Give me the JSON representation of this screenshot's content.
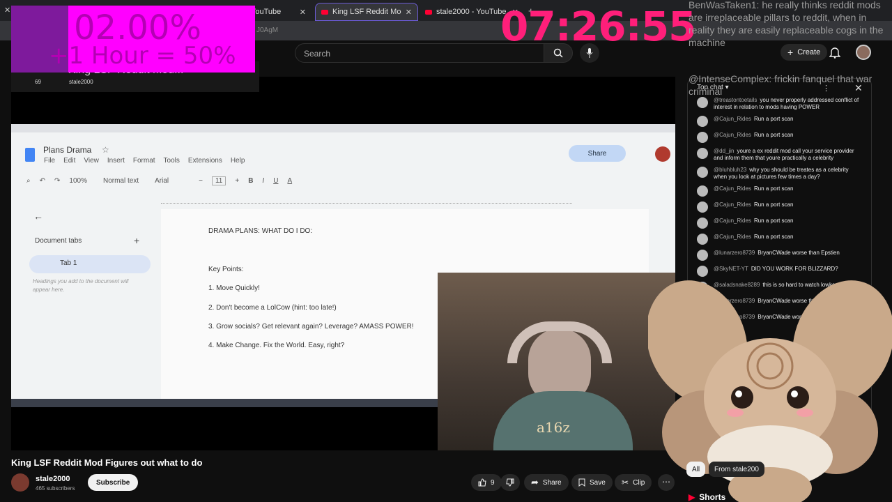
{
  "browser": {
    "tabs": [
      {
        "label": "YouTube",
        "active": false
      },
      {
        "label": "King LSF Reddit Mod Figur",
        "active": true
      },
      {
        "label": "stale2000 - YouTube",
        "active": false
      }
    ],
    "url_fragment": "J0AgM"
  },
  "overlay": {
    "percent": "02.00%",
    "rule": "+1 Hour = 50%",
    "clock": "07:26:55"
  },
  "header": {
    "search_placeholder": "Search",
    "create_label": "Create"
  },
  "mini_player": {
    "title": "King LSF Reddit Mod...",
    "views": "69",
    "channel": "stale2000"
  },
  "doc": {
    "title": "Plans Drama",
    "menu": [
      "File",
      "Edit",
      "View",
      "Insert",
      "Format",
      "Tools",
      "Extensions",
      "Help"
    ],
    "zoom": "100%",
    "style": "Normal text",
    "font": "Arial",
    "font_size": "11",
    "share_label": "Share",
    "document_tabs_label": "Document tabs",
    "tab1_label": "Tab 1",
    "headings_hint": "Headings you add to the document will appear here.",
    "lines": [
      "DRAMA PLANS:  WHAT DO I DO:",
      "Key Points:",
      "1. Move Quickly!",
      "2.  Don't become a LolCow (hint: too late!)",
      "3. Grow socials?  Get relevant again?  Leverage? AMASS POWER!",
      "4. Make Change.  Fix the World. Easy, right?"
    ]
  },
  "webcam": {
    "shirt_text": "a16z"
  },
  "video": {
    "title": "King LSF Reddit Mod Figures out what to do",
    "channel": "stale2000",
    "subscribers": "465 subscribers",
    "subscribe_label": "Subscribe",
    "likes": "9",
    "share_label": "Share",
    "save_label": "Save",
    "clip_label": "Clip"
  },
  "chat": {
    "overlay_top": "BenWasTaken1: he really thinks reddit mods are irreplaceable pillars to reddit, when in reality they are easily replaceable cogs in the machine",
    "overlay_second": "@IntenseComplex: frickin fanquel that war criminal",
    "header": "Top chat",
    "messages": [
      {
        "name": "@treastontoetails",
        "text": "you never properly addressed conflict of interest in relation to mods having POWER"
      },
      {
        "name": "@Cajun_Rides",
        "text": "Run a port scan"
      },
      {
        "name": "@Cajun_Rides",
        "text": "Run a port scan"
      },
      {
        "name": "@dd_jin",
        "text": "youre a ex reddit mod call your service provider and inform them that youre practically a celebrity"
      },
      {
        "name": "@bluhbluh23",
        "text": "why you should be treates as a celebrity when you look at pictures few times a day?"
      },
      {
        "name": "@Cajun_Rides",
        "text": "Run a port scan"
      },
      {
        "name": "@Cajun_Rides",
        "text": "Run a port scan"
      },
      {
        "name": "@Cajun_Rides",
        "text": "Run a port scan"
      },
      {
        "name": "@Cajun_Rides",
        "text": "Run a port scan"
      },
      {
        "name": "@lunarzero8739",
        "text": "BryanCWade worse than Epstien"
      },
      {
        "name": "@SkyNET-YT",
        "text": "DID YOU WORK FOR BLIZZARD?"
      },
      {
        "name": "@saladsnake8289",
        "text": "this is so hard to watch lowkey"
      },
      {
        "name": "@lunarzero8739",
        "text": "BryanCWade worse than Epstien"
      },
      {
        "name": "@lunarzero8739",
        "text": "BryanCWade worse than Epstien"
      }
    ]
  },
  "sidebar": {
    "chip_all": "All",
    "chip_from": "From stale200",
    "shorts_label": "Shorts"
  },
  "colors": {
    "accent_pink": "#ff1f7a",
    "overlay_magenta": "#ff00ff",
    "youtube_red": "#ff0033"
  }
}
